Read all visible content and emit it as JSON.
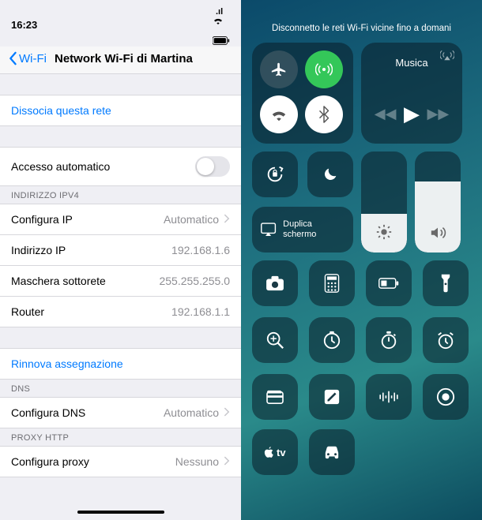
{
  "left": {
    "status": {
      "time": "16:23",
      "signal": "••ıl",
      "wifi": "wifi-icon",
      "battery": "battery-icon"
    },
    "nav": {
      "back": "Wi-Fi",
      "title": "Network Wi-Fi di Martina"
    },
    "forget": "Dissocia questa rete",
    "autojoin": {
      "label": "Accesso automatico",
      "enabled": false
    },
    "ipv4": {
      "header": "INDIRIZZO IPV4",
      "configure": {
        "label": "Configura IP",
        "value": "Automatico"
      },
      "ip": {
        "label": "Indirizzo IP",
        "value": "192.168.1.6"
      },
      "mask": {
        "label": "Maschera sottorete",
        "value": "255.255.255.0"
      },
      "router": {
        "label": "Router",
        "value": "192.168.1.1"
      }
    },
    "renew": "Rinnova assegnazione",
    "dns": {
      "header": "DNS",
      "configure": {
        "label": "Configura DNS",
        "value": "Automatico"
      }
    },
    "proxy": {
      "header": "PROXY HTTP",
      "configure": {
        "label": "Configura proxy",
        "value": "Nessuno"
      }
    }
  },
  "cc": {
    "headline": "Disconnetto le reti Wi-Fi vicine fino a domani",
    "music_label": "Musica",
    "mirror_label": "Duplica schermo",
    "icons": {
      "airplane": "airplane-icon",
      "cellular": "cellular-icon",
      "wifi": "wifi-icon",
      "bluetooth": "bluetooth-icon",
      "lock": "orientation-lock-icon",
      "dnd": "moon-icon",
      "mirror": "screen-mirroring-icon",
      "camera": "camera-icon",
      "calculator": "calculator-icon",
      "battery": "low-power-icon",
      "flash": "flashlight-icon",
      "magnifier": "magnifier-icon",
      "timer": "timer-icon",
      "stopwatch": "stopwatch-icon",
      "alarm": "alarm-icon",
      "wallet": "wallet-icon",
      "notes": "note-icon",
      "voice": "voice-memo-icon",
      "record": "screen-record-icon",
      "tv": "appletv-icon",
      "car": "carplay-icon"
    }
  }
}
